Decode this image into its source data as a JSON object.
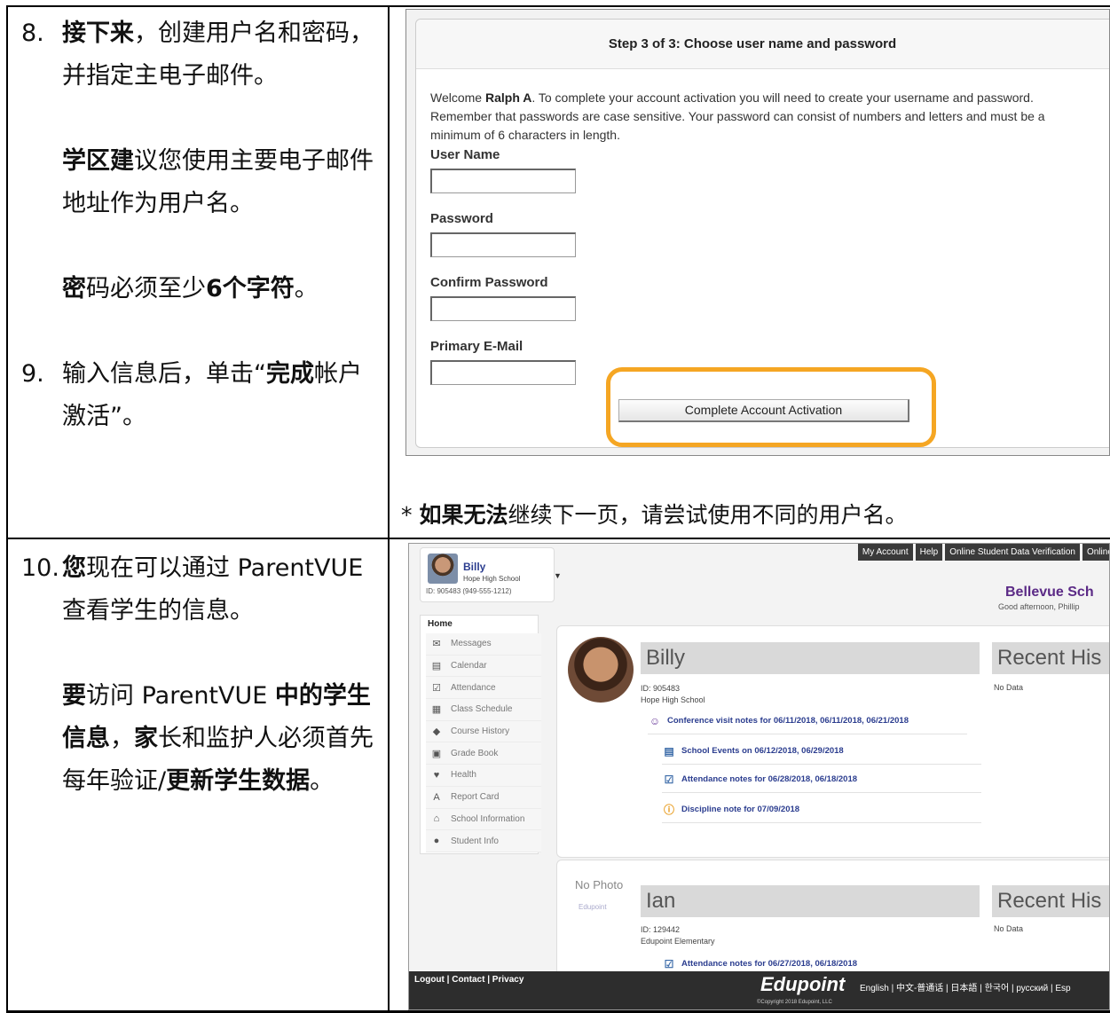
{
  "instructions": {
    "step8": {
      "num": "8.",
      "line1_bold": "接下来",
      "line1_rest": "，创建用户名和密码，并指定主电子邮件。",
      "para2_bold": "学区建",
      "para2_rest": "议您使用主要电子邮件地址作为用户名。",
      "para3_bold1": "密",
      "para3_mid": "码必须至少",
      "para3_bold2": "6个字符",
      "para3_end": "。"
    },
    "step9": {
      "num": "9.",
      "pre": "输入信息后，单击“",
      "bold": "完成",
      "rest": "帐户激活”。"
    },
    "note": {
      "star": "* ",
      "bold": "如果无法",
      "rest": "继续下一页，请尝试使用不同的用户名。"
    },
    "step10": {
      "num": "10.",
      "p1_bold": "您",
      "p1_rest": "现在可以通过 ParentVUE 查看学生的信息。",
      "p2_bold1": "要",
      "p2_t1": "访问 ParentVUE ",
      "p2_bold2": "中的学生信息",
      "p2_t2": "，",
      "p2_bold3": "家",
      "p2_t3": "长和监护人必须首先每年验证/",
      "p2_bold4": "更新学生数据",
      "p2_t4": "。"
    }
  },
  "activation": {
    "heading": "Step 3 of 3: Choose user name and password",
    "welcome_pre": "Welcome ",
    "welcome_name": "Ralph A",
    "welcome_rest": ". To complete your account activation you will need to create your username and password. Remember that passwords are case sensitive. Your password can consist of numbers and letters and must be a minimum of 6 characters in length.",
    "fields": [
      {
        "label": "User Name",
        "value": ""
      },
      {
        "label": "Password",
        "value": ""
      },
      {
        "label": "Confirm Password",
        "value": ""
      },
      {
        "label": "Primary E-Mail",
        "value": ""
      }
    ],
    "submit": "Complete Account Activation",
    "highlight_color": "#f5a623"
  },
  "parentvue": {
    "selector": {
      "name": "Billy",
      "school": "Hope High School",
      "id_line": "ID: 905483  (949-555-1212)"
    },
    "top_buttons": [
      "My Account",
      "Help",
      "Online Student Data Verification",
      "Online Regist"
    ],
    "district": "Bellevue Sch",
    "greeting": "Good afternoon, Phillip",
    "home_label": "Home",
    "nav": [
      {
        "label": "Messages",
        "icon": "envelope-icon"
      },
      {
        "label": "Calendar",
        "icon": "calendar-icon"
      },
      {
        "label": "Attendance",
        "icon": "checkbox-icon"
      },
      {
        "label": "Class Schedule",
        "icon": "schedule-icon"
      },
      {
        "label": "Course History",
        "icon": "course-icon"
      },
      {
        "label": "Grade Book",
        "icon": "gradebook-icon"
      },
      {
        "label": "Health",
        "icon": "health-icon"
      },
      {
        "label": "Report Card",
        "icon": "report-card-icon"
      },
      {
        "label": "School Information",
        "icon": "school-icon"
      },
      {
        "label": "Student Info",
        "icon": "student-icon"
      }
    ],
    "student1": {
      "name": "Billy",
      "id": "ID: 905483",
      "school": "Hope High School",
      "recent": "Recent His",
      "nodata": "No Data",
      "events": [
        "Conference visit notes for 06/11/2018, 06/11/2018, 06/21/2018",
        "School Events on 06/12/2018, 06/29/2018",
        "Attendance notes for 06/28/2018, 06/18/2018",
        "Discipline note for 07/09/2018"
      ]
    },
    "student2": {
      "nophoto": "No Photo",
      "logo_text": "Edupoint",
      "name": "Ian",
      "id": "ID: 129442",
      "school": "Edupoint Elementary",
      "recent": "Recent His",
      "nodata": "No Data",
      "events": [
        "Attendance notes for 06/27/2018, 06/18/2018"
      ]
    },
    "footer": {
      "links": "Logout  | Contact  | Privacy",
      "brand": "Edupoint",
      "copyright": "©Copyright 2018 Edupoint, LLC",
      "languages": "English  | 中文-普通话  | 日本語  | 한국어  | русский  | Esp"
    }
  }
}
